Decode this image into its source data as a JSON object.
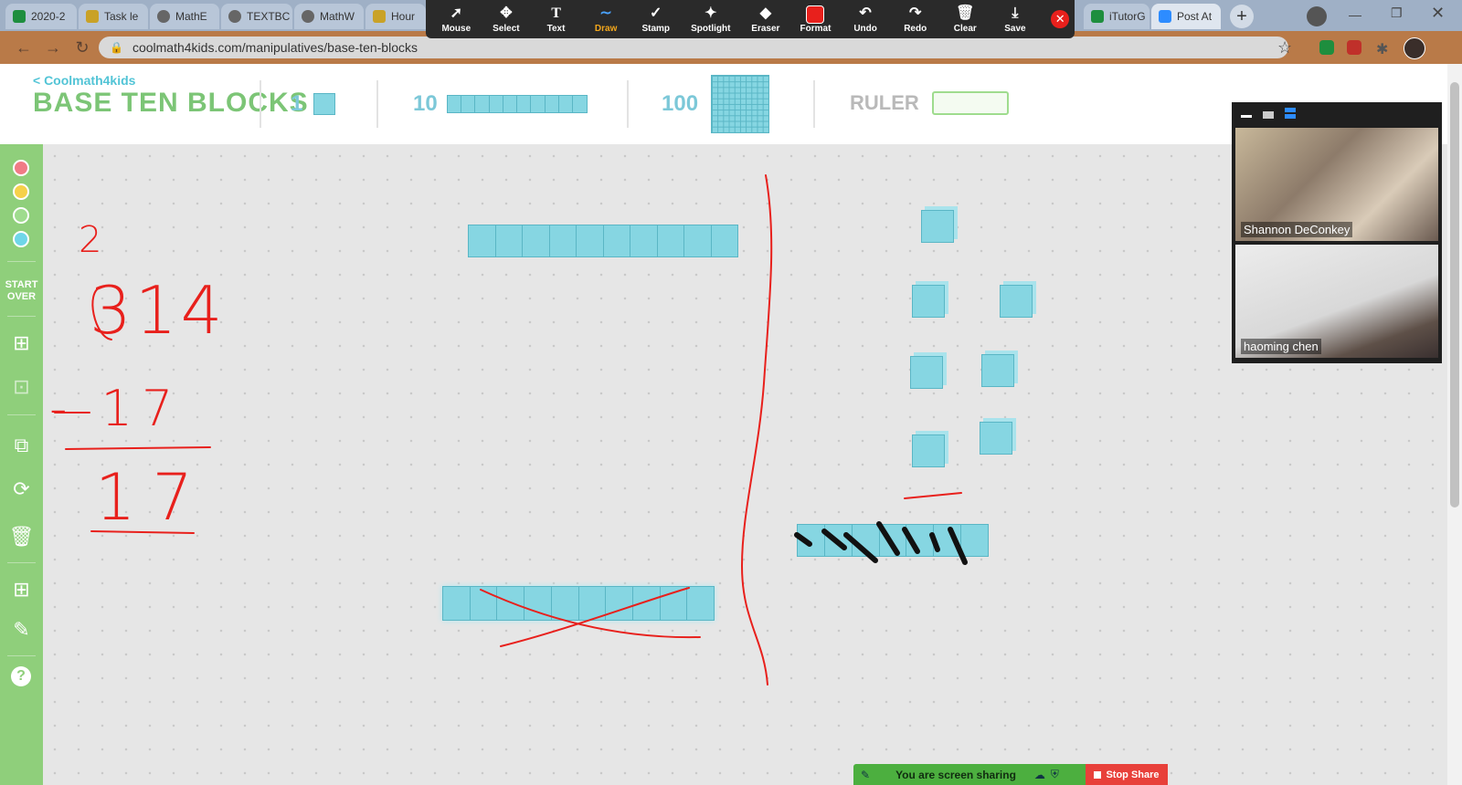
{
  "browser": {
    "tabs": [
      {
        "label": "2020-2",
        "color": "#1e8e3e"
      },
      {
        "label": "Task le",
        "color": "#c9a227"
      },
      {
        "label": "MathE",
        "color": "#666666"
      },
      {
        "label": "TEXTBC",
        "color": "#666666"
      },
      {
        "label": "MathW",
        "color": "#666666"
      },
      {
        "label": "Hour",
        "color": "#c9a227"
      },
      {
        "label": "iTutorG",
        "color": "#1e8e3e"
      },
      {
        "label": "Post At",
        "color": "#2d8cff"
      }
    ],
    "new_tab": "+",
    "url": "coolmath4kids.com/manipulatives/base-ten-blocks"
  },
  "annotation_toolbar": {
    "tools": [
      {
        "label": "Mouse",
        "icon": "cursor-icon",
        "glyph": "➚"
      },
      {
        "label": "Select",
        "icon": "move-icon",
        "glyph": "✥"
      },
      {
        "label": "Text",
        "icon": "text-icon",
        "glyph": "T"
      },
      {
        "label": "Draw",
        "icon": "draw-icon",
        "glyph": "∼"
      },
      {
        "label": "Stamp",
        "icon": "stamp-icon",
        "glyph": "✓"
      },
      {
        "label": "Spotlight",
        "icon": "spotlight-icon",
        "glyph": "✦"
      },
      {
        "label": "Eraser",
        "icon": "eraser-icon",
        "glyph": "◆"
      },
      {
        "label": "Format",
        "icon": "format-icon",
        "glyph": "■"
      },
      {
        "label": "Undo",
        "icon": "undo-icon",
        "glyph": "↶"
      },
      {
        "label": "Redo",
        "icon": "redo-icon",
        "glyph": "↷"
      },
      {
        "label": "Clear",
        "icon": "trash-icon",
        "glyph": "🗑"
      },
      {
        "label": "Save",
        "icon": "save-icon",
        "glyph": "⤓"
      }
    ],
    "active_tool": "Draw",
    "active_color": "#f4a81c",
    "format_color": "#e8201c"
  },
  "header": {
    "logo": "< Coolmath4kids",
    "title": "BASE TEN BLOCKS",
    "block_one_label": "1",
    "block_ten_label": "10",
    "block_hundred_label": "100",
    "ruler_label": "RULER"
  },
  "sidebar": {
    "colors": [
      "#f07b86",
      "#f5d14a",
      "#9fdc8e",
      "#6fd6e8"
    ],
    "start_over": "START OVER"
  },
  "canvas": {
    "annotations": {
      "borrow_digit": "2",
      "top_number": "314",
      "subtract_number": "- 17",
      "result": "17"
    },
    "block_color": "#86d6e2",
    "ink_color": "#e8201c"
  },
  "video": {
    "participants": [
      {
        "name": "Shannon DeConkey"
      },
      {
        "name": "haoming chen"
      }
    ]
  },
  "share_bar": {
    "message": "You are screen sharing",
    "stop_label": "Stop Share"
  }
}
